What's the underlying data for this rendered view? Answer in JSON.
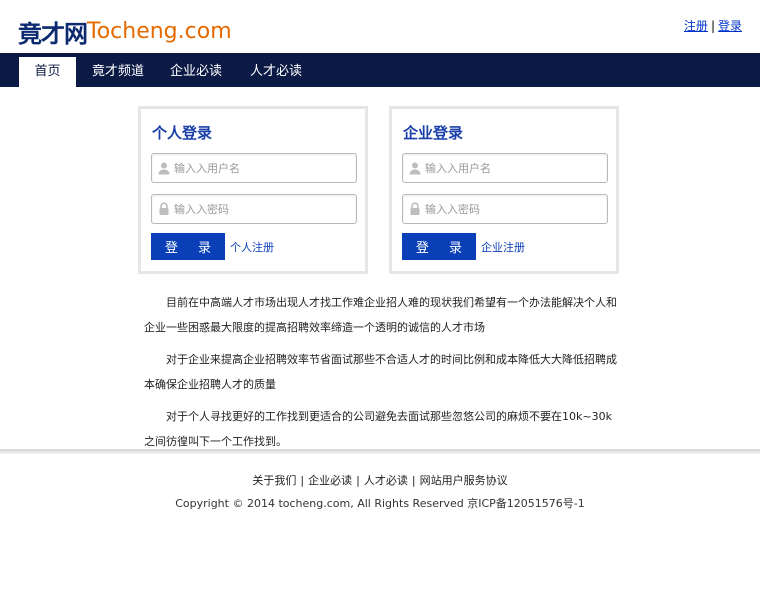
{
  "header": {
    "logo_cn": "竟才网",
    "logo_en": "Tocheng.com",
    "links": {
      "register": "注册",
      "separator": "|",
      "login": "登录"
    }
  },
  "nav": {
    "items": [
      {
        "label": "首页",
        "active": true
      },
      {
        "label": "竟才频道",
        "active": false
      },
      {
        "label": "企业必读",
        "active": false
      },
      {
        "label": "人才必读",
        "active": false
      }
    ]
  },
  "personal_login": {
    "title": "个人登录",
    "username_placeholder": "输入入用户名",
    "password_placeholder": "输入入密码",
    "button": "登 录",
    "register_link": "个人注册"
  },
  "company_login": {
    "title": "企业登录",
    "username_placeholder": "输入入用户名",
    "password_placeholder": "输入入密码",
    "button": "登 录",
    "register_link": "企业注册"
  },
  "intro": {
    "paragraphs": [
      "目前在中高端人才市场出现人才找工作难企业招人难的现状我们希望有一个办法能解决个人和企业一些困惑最大限度的提高招聘效率缔造一个透明的诚信的人才市场",
      "对于企业来提高企业招聘效率节省面试那些不合适人才的时间比例和成本降低大大降低招聘成本确保企业招聘人才的质量",
      "对于个人寻找更好的工作找到更适合的公司避免去面试那些忽悠公司的麻烦不要在10k~30k之间彷徨叫下一个工作找到。"
    ]
  },
  "footer": {
    "links": [
      "关于我们",
      "企业必读",
      "人才必读",
      "网站用户服务协议"
    ],
    "separator": "|",
    "copyright": "Copyright © 2014 tocheng.com, All Rights Reserved 京ICP备12051576号-1"
  }
}
